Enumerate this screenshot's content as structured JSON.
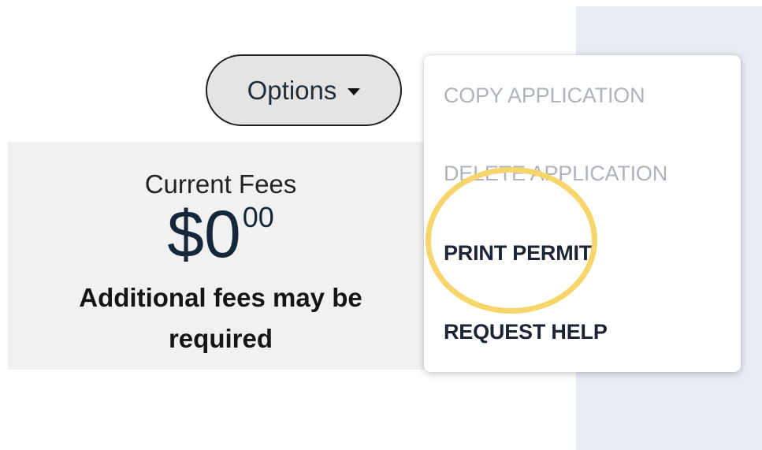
{
  "options_button": {
    "label": "Options",
    "icon": "caret-down-icon"
  },
  "fees": {
    "title": "Current Fees",
    "amount_dollars": "$0",
    "amount_cents": "00",
    "note_line1": "Additional fees may be",
    "note_line2": "required"
  },
  "menu": {
    "items": [
      {
        "label": "COPY APPLICATION",
        "enabled": false
      },
      {
        "label": "DELETE APPLICATION",
        "enabled": false
      },
      {
        "label": "PRINT PERMIT",
        "enabled": true
      },
      {
        "label": "REQUEST HELP",
        "enabled": true
      }
    ]
  },
  "colors": {
    "highlight": "#f6d56a",
    "disabled_text": "#aeb4ba",
    "amount_text": "#14283a"
  }
}
